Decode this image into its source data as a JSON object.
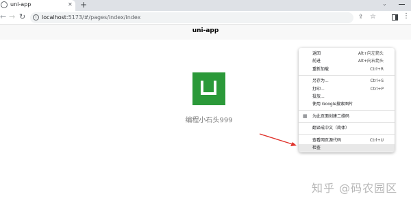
{
  "browser": {
    "tab_title": "uni-app",
    "new_tab_symbol": "+",
    "url_host": "localhost",
    "url_path": ":5173/#/pages/index/index"
  },
  "app": {
    "nav_title": "uni-app",
    "subtitle": "编程小石头999",
    "brand_color": "#2b9939"
  },
  "context_menu": {
    "groups": [
      [
        {
          "label": "返回",
          "shortcut": "Alt+向左箭头"
        },
        {
          "label": "前进",
          "shortcut": "Alt+向右箭头"
        },
        {
          "label": "重新加载",
          "shortcut": "Ctrl+R"
        }
      ],
      [
        {
          "label": "另存为...",
          "shortcut": "Ctrl+S"
        },
        {
          "label": "打印...",
          "shortcut": "Ctrl+P"
        },
        {
          "label": "投放...",
          "shortcut": ""
        },
        {
          "label": "使用 Google搜索图片",
          "shortcut": ""
        }
      ],
      [
        {
          "label": "为此页面创建二维码",
          "shortcut": "",
          "icon": "qr-code-icon"
        }
      ],
      [
        {
          "label": "翻译成中文（简体）",
          "shortcut": ""
        }
      ],
      [
        {
          "label": "查看网页源代码",
          "shortcut": "Ctrl+U"
        },
        {
          "label": "检查",
          "shortcut": "",
          "highlighted": true
        }
      ]
    ]
  },
  "annotation": {
    "arrow_color": "#e0322b"
  },
  "watermark": "知乎 @码农园区"
}
